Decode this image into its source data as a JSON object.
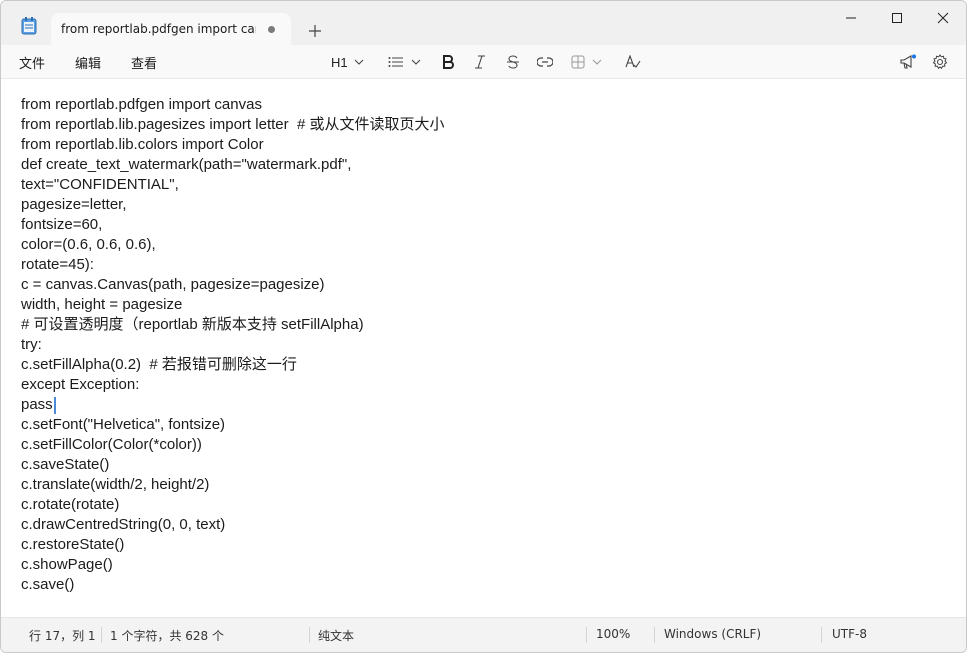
{
  "tab": {
    "title": "from reportlab.pdfgen import canva"
  },
  "menu": {
    "file": "文件",
    "edit": "编辑",
    "view": "查看"
  },
  "format": {
    "heading": "H1"
  },
  "icons": {
    "app": "notepad-icon",
    "new_tab": "plus-icon",
    "minimize": "minimize-icon",
    "maximize": "maximize-icon",
    "close": "close-icon",
    "list": "bulleted-list-icon",
    "bold": "bold-icon",
    "italic": "italic-icon",
    "strike": "strikethrough-icon",
    "link": "link-icon",
    "table": "table-icon",
    "clear_format": "clear-formatting-icon",
    "copilot": "megaphone-icon",
    "settings": "gear-icon"
  },
  "editor": {
    "lines": [
      "from reportlab.pdfgen import canvas",
      "from reportlab.lib.pagesizes import letter  # 或从文件读取页大小",
      "from reportlab.lib.colors import Color",
      "def create_text_watermark(path=\"watermark.pdf\",",
      "text=\"CONFIDENTIAL\",",
      "pagesize=letter,",
      "fontsize=60,",
      "color=(0.6, 0.6, 0.6),",
      "rotate=45):",
      "c = canvas.Canvas(path, pagesize=pagesize)",
      "width, height = pagesize",
      "# 可设置透明度（reportlab 新版本支持 setFillAlpha)",
      "try:",
      "c.setFillAlpha(0.2)  # 若报错可删除这一行",
      "except Exception:",
      "pass",
      "c.setFont(\"Helvetica\", fontsize)",
      "c.setFillColor(Color(*color))",
      "c.saveState()",
      "c.translate(width/2, height/2)",
      "c.rotate(rotate)",
      "c.drawCentredString(0, 0, text)",
      "c.restoreState()",
      "c.showPage()",
      "c.save()"
    ]
  },
  "status": {
    "position": "行 17，列 1",
    "chars": "1 个字符，共 628 个",
    "mode": "纯文本",
    "zoom": "100%",
    "line_ending": "Windows (CRLF)",
    "encoding": "UTF-8"
  },
  "colors": {
    "caret": "#4c8bd6",
    "notify_dot": "#1a73e8"
  }
}
